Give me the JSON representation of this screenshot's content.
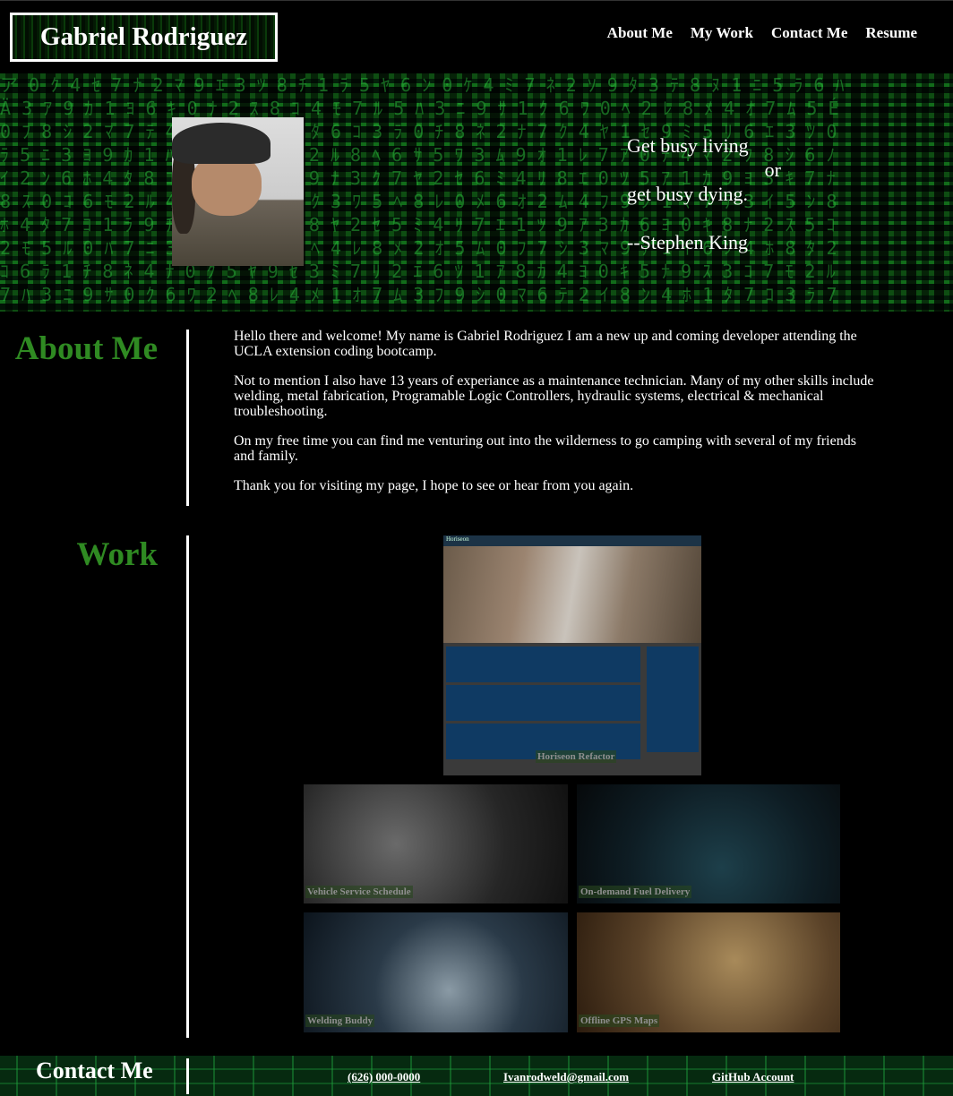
{
  "header": {
    "logo": "Gabriel Rodriguez",
    "nav": [
      "About Me",
      "My Work",
      "Contact Me",
      "Resume"
    ]
  },
  "hero": {
    "quote_lines": [
      "Get busy living",
      "or",
      "get busy dying.",
      "--Stephen King"
    ]
  },
  "about": {
    "title": "About Me",
    "paragraphs": [
      "Hello there and welcome! My name is Gabriel Rodriguez I am a new up and coming developer attending the UCLA extension coding bootcamp.",
      "Not to mention I also have 13 years of experiance as a maintenance technician. Many of my other skills include welding, metal fabrication, Programable Logic Controllers, hydraulic systems, electrical & mechanical troubleshooting.",
      "On my free time you can find me venturing out into the wilderness to go camping with several of my friends and family.",
      "Thank you for visiting my page, I hope to see or hear from you again."
    ]
  },
  "work": {
    "title": "Work",
    "projects": [
      "Horiseon Refactor",
      "Vehicle Service Schedule",
      "On-demand Fuel Delivery",
      "Welding Buddy",
      "Offline GPS Maps"
    ],
    "horiseon_header": "Horiseon"
  },
  "footer": {
    "title": "Contact Me",
    "phone": "(626) 000-0000",
    "email": "Ivanrodweld@gmail.com",
    "github": "GitHub Account"
  },
  "colors": {
    "accent_green": "#2f8a22",
    "background": "#000000"
  }
}
